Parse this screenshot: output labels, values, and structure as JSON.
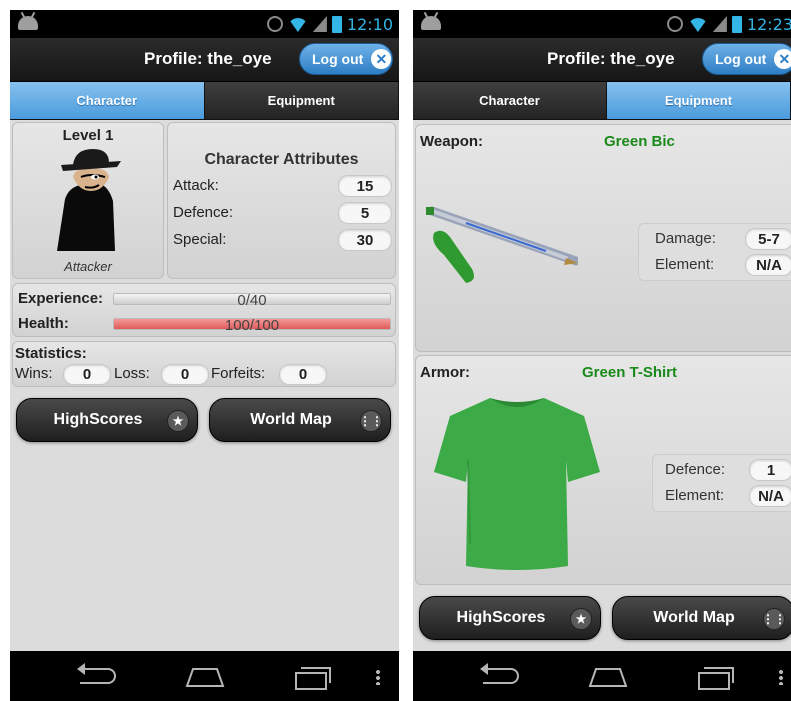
{
  "left": {
    "status": {
      "time": "12:10"
    },
    "header": {
      "title": "Profile: the_oye",
      "logout_label": "Log out"
    },
    "tabs": [
      {
        "label": "Character",
        "active": true
      },
      {
        "label": "Equipment",
        "active": false
      }
    ],
    "character": {
      "level": "Level 1",
      "class": "Attacker",
      "attributes_title": "Character Attributes",
      "attributes": [
        {
          "label": "Attack:",
          "value": "15"
        },
        {
          "label": "Defence:",
          "value": "5"
        },
        {
          "label": "Special:",
          "value": "30"
        }
      ]
    },
    "bars": {
      "experience_label": "Experience:",
      "experience_text": "0/40",
      "experience_fraction": 0.0,
      "health_label": "Health:",
      "health_text": "100/100",
      "health_fraction": 1.0
    },
    "statistics": {
      "title": "Statistics:",
      "wins_label": "Wins:",
      "wins": "0",
      "loss_label": "Loss:",
      "loss": "0",
      "forfeits_label": "Forfeits:",
      "forfeits": "0"
    },
    "buttons": {
      "highscores": "HighScores",
      "worldmap": "World Map"
    }
  },
  "right": {
    "status": {
      "time": "12:23"
    },
    "header": {
      "title": "Profile: the_oye",
      "logout_label": "Log out"
    },
    "tabs": [
      {
        "label": "Character",
        "active": false
      },
      {
        "label": "Equipment",
        "active": true
      }
    ],
    "weapon": {
      "label": "Weapon:",
      "name": "Green Bic",
      "stats": [
        {
          "label": "Damage:",
          "value": "5-7"
        },
        {
          "label": "Element:",
          "value": "N/A"
        }
      ]
    },
    "armor": {
      "label": "Armor:",
      "name": "Green T-Shirt",
      "stats": [
        {
          "label": "Defence:",
          "value": "1"
        },
        {
          "label": "Element:",
          "value": "N/A"
        }
      ]
    },
    "buttons": {
      "highscores": "HighScores",
      "worldmap": "World Map"
    }
  },
  "colors": {
    "accent_blue": "#4a9bdc",
    "item_green": "#1a8a1a",
    "health_red": "#e86a6a"
  }
}
